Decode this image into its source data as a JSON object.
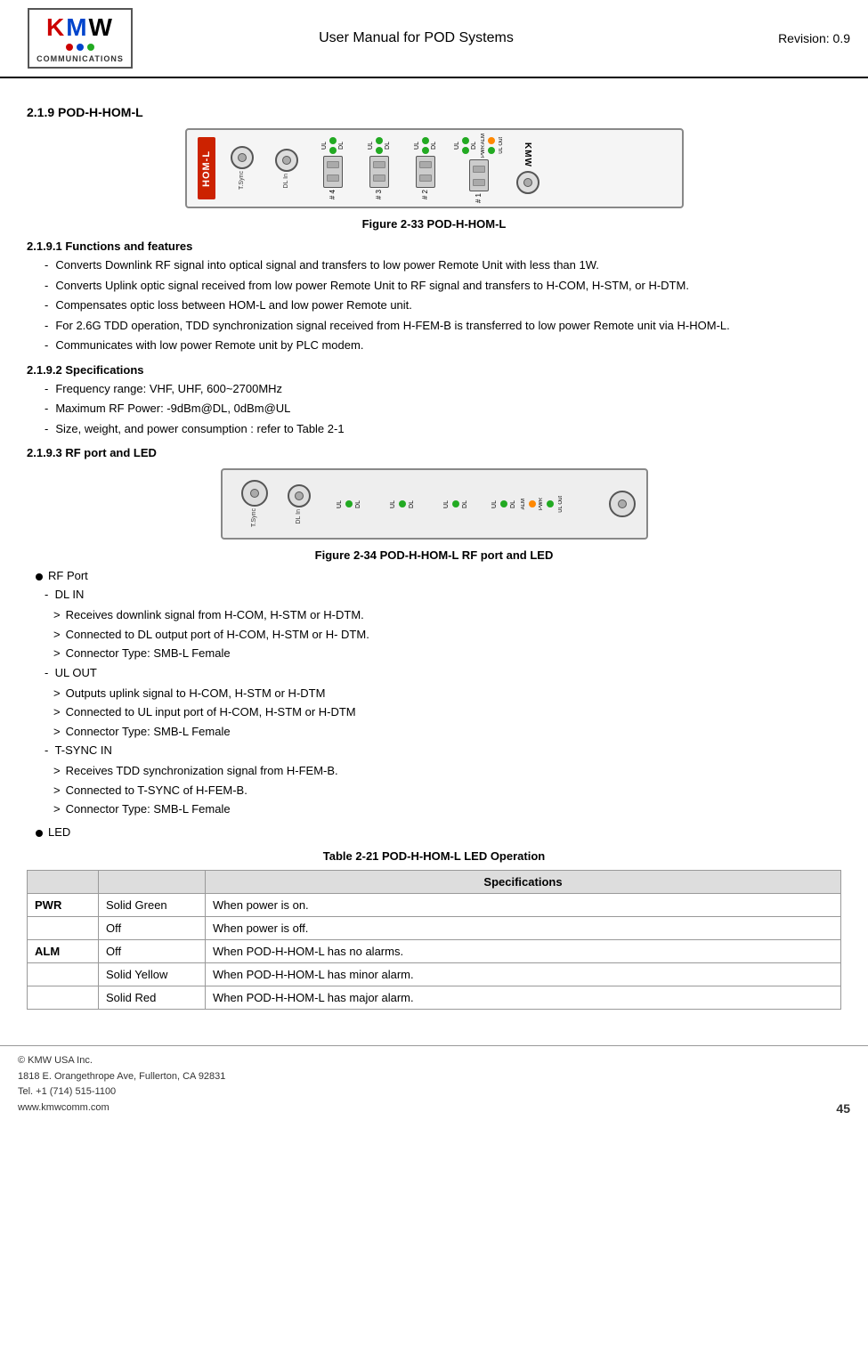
{
  "header": {
    "title": "User Manual for POD Systems",
    "revision": "Revision: 0.9",
    "logo_text": "KMW",
    "logo_sub": "COMMUNICATIONS"
  },
  "section_2_1_9": {
    "heading": "2.1.9    POD-H-HOM-L",
    "figure_33_caption": "Figure 2-33          POD-H-HOM-L",
    "sub_2_1_9_1": {
      "heading": "2.1.9.1    Functions and features",
      "items": [
        "Converts Downlink RF signal into optical signal and transfers to low power Remote Unit with less than 1W.",
        "Converts Uplink optic signal received from low power Remote Unit to RF signal and transfers to H-COM, H-STM, or H-DTM.",
        "Compensates optic loss between HOM-L and low power Remote unit.",
        "For 2.6G TDD operation, TDD synchronization signal received from H-FEM-B is transferred to low power Remote unit via H-HOM-L.",
        "Communicates with low power Remote unit by PLC modem."
      ]
    },
    "sub_2_1_9_2": {
      "heading": "2.1.9.2    Specifications",
      "items": [
        "Frequency range: VHF, UHF, 600~2700MHz",
        "Maximum RF Power: -9dBm@DL, 0dBm@UL",
        "Size, weight, and power consumption : refer to Table 2-1"
      ]
    },
    "sub_2_1_9_3": {
      "heading": "2.1.9.3    RF port and LED",
      "figure_34_caption": "Figure 2-34          POD-H-HOM-L RF port and LED",
      "rf_port_heading": "RF Port",
      "dl_in": {
        "label": "DL IN",
        "items": [
          "Receives downlink signal from H-COM, H-STM or H-DTM.",
          "Connected to DL output port of H-COM, H-STM or H- DTM.",
          "Connector Type: SMB-L Female"
        ]
      },
      "ul_out": {
        "label": "UL OUT",
        "items": [
          "Outputs uplink signal to H-COM, H-STM or H-DTM",
          "Connected to UL input port of H-COM, H-STM or H-DTM",
          "Connector Type: SMB-L Female"
        ]
      },
      "tsync_in": {
        "label": "T-SYNC IN",
        "items": [
          "Receives TDD synchronization signal from H-FEM-B.",
          "Connected to T-SYNC of H-FEM-B.",
          "Connector Type: SMB-L Female"
        ]
      },
      "led_heading": "LED",
      "table_caption": "Table 2-21     POD-H-HOM-L LED Operation",
      "table_header_col1": "",
      "table_header_col2": "",
      "table_header_col3": "Specifications",
      "table_rows": [
        {
          "col1": "PWR",
          "col2": "Solid Green",
          "col3": "When power is on."
        },
        {
          "col1": "",
          "col2": "Off",
          "col3": "When power is off."
        },
        {
          "col1": "ALM",
          "col2": "Off",
          "col3": "When POD-H-HOM-L has no alarms."
        },
        {
          "col1": "",
          "col2": "Solid Yellow",
          "col3": "When POD-H-HOM-L has minor alarm."
        },
        {
          "col1": "",
          "col2": "Solid Red",
          "col3": "When POD-H-HOM-L has major alarm."
        }
      ]
    }
  },
  "footer": {
    "copyright": "© KMW USA Inc.",
    "address1": "1818 E. Orangethrope Ave, Fullerton, CA 92831",
    "phone": "Tel. +1 (714) 515-1100",
    "website": "www.kmwcomm.com",
    "page_number": "45"
  }
}
